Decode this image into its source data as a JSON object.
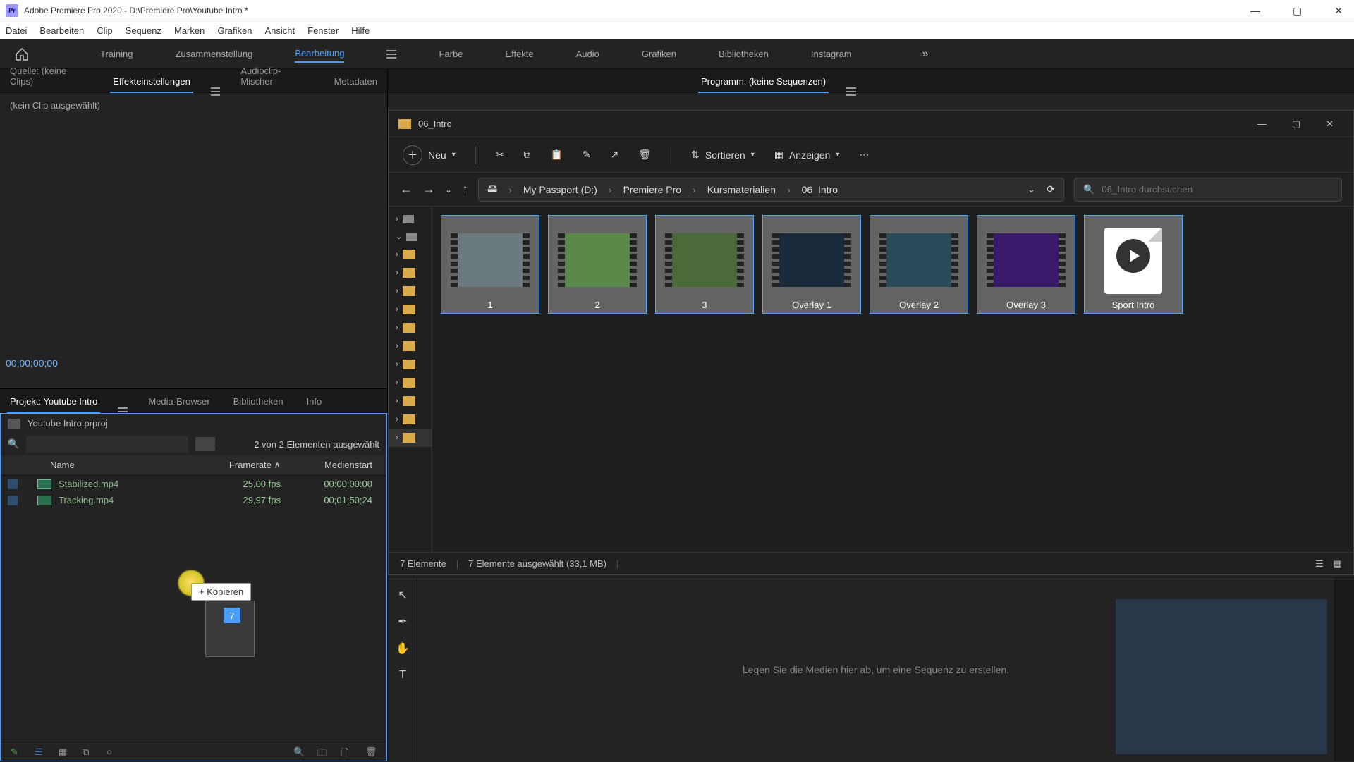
{
  "title_bar": {
    "app_name": "Adobe Premiere Pro 2020",
    "project_path": "D:\\Premiere Pro\\Youtube Intro *"
  },
  "menu": [
    "Datei",
    "Bearbeiten",
    "Clip",
    "Sequenz",
    "Marken",
    "Grafiken",
    "Ansicht",
    "Fenster",
    "Hilfe"
  ],
  "workspaces": [
    "Training",
    "Zusammenstellung",
    "Bearbeitung",
    "Farbe",
    "Effekte",
    "Audio",
    "Grafiken",
    "Bibliotheken",
    "Instagram"
  ],
  "workspace_active": "Bearbeitung",
  "source_tabs": {
    "source_label": "Quelle: (keine Clips)",
    "effects_label": "Effekteinstellungen",
    "audiomixer_label": "Audioclip-Mischer",
    "metadata_label": "Metadaten"
  },
  "source_panel": {
    "no_clip": "(kein Clip ausgewählt)",
    "timecode": "00;00;00;00"
  },
  "program_tab": "Programm: (keine Sequenzen)",
  "project_tabs": {
    "project": "Projekt: Youtube Intro",
    "media": "Media-Browser",
    "libs": "Bibliotheken",
    "info": "Info"
  },
  "project_panel": {
    "filename": "Youtube Intro.prproj",
    "selection_text": "2 von 2 Elementen ausgewählt",
    "columns": {
      "name": "Name",
      "framerate": "Framerate",
      "mediastart": "Medienstart"
    },
    "rows": [
      {
        "name": "Stabilized.mp4",
        "framerate": "25,00 fps",
        "mediastart": "00:00:00:00"
      },
      {
        "name": "Tracking.mp4",
        "framerate": "29,97 fps",
        "mediastart": "00;01;50;24"
      }
    ],
    "drag_label": "+ Kopieren",
    "drag_count": "7"
  },
  "explorer": {
    "title": "06_Intro",
    "new_btn": "Neu",
    "sort_btn": "Sortieren",
    "view_btn": "Anzeigen",
    "breadcrumb": [
      "My Passport (D:)",
      "Premiere Pro",
      "Kursmaterialien",
      "06_Intro"
    ],
    "search_placeholder": "06_Intro durchsuchen",
    "files": [
      {
        "name": "1",
        "kind": "video",
        "bg": "#6a7a7f"
      },
      {
        "name": "2",
        "kind": "video",
        "bg": "#5a8a4a"
      },
      {
        "name": "3",
        "kind": "video",
        "bg": "#4a6a3a"
      },
      {
        "name": "Overlay 1",
        "kind": "video",
        "bg": "#1a2a3a"
      },
      {
        "name": "Overlay 2",
        "kind": "video",
        "bg": "#2a4a5a"
      },
      {
        "name": "Overlay 3",
        "kind": "video",
        "bg": "#3a1a6a"
      },
      {
        "name": "Sport Intro",
        "kind": "proj",
        "bg": "#fff"
      }
    ],
    "status_items": "7 Elemente",
    "status_selected": "7 Elemente ausgewählt (33,1 MB)"
  },
  "timeline": {
    "drop_hint": "Legen Sie die Medien hier ab, um eine Sequenz zu erstellen."
  },
  "icons": {
    "home": "home-icon",
    "search": "search-icon",
    "cut": "cut-icon",
    "copy": "copy-icon",
    "paste": "paste-icon",
    "rename": "rename-icon",
    "share": "share-icon",
    "delete": "delete-icon",
    "sort": "sort-icon",
    "view": "view-icon",
    "more": "more-icon",
    "back": "back-icon",
    "forward": "forward-icon",
    "up": "up-icon",
    "refresh": "refresh-icon"
  }
}
